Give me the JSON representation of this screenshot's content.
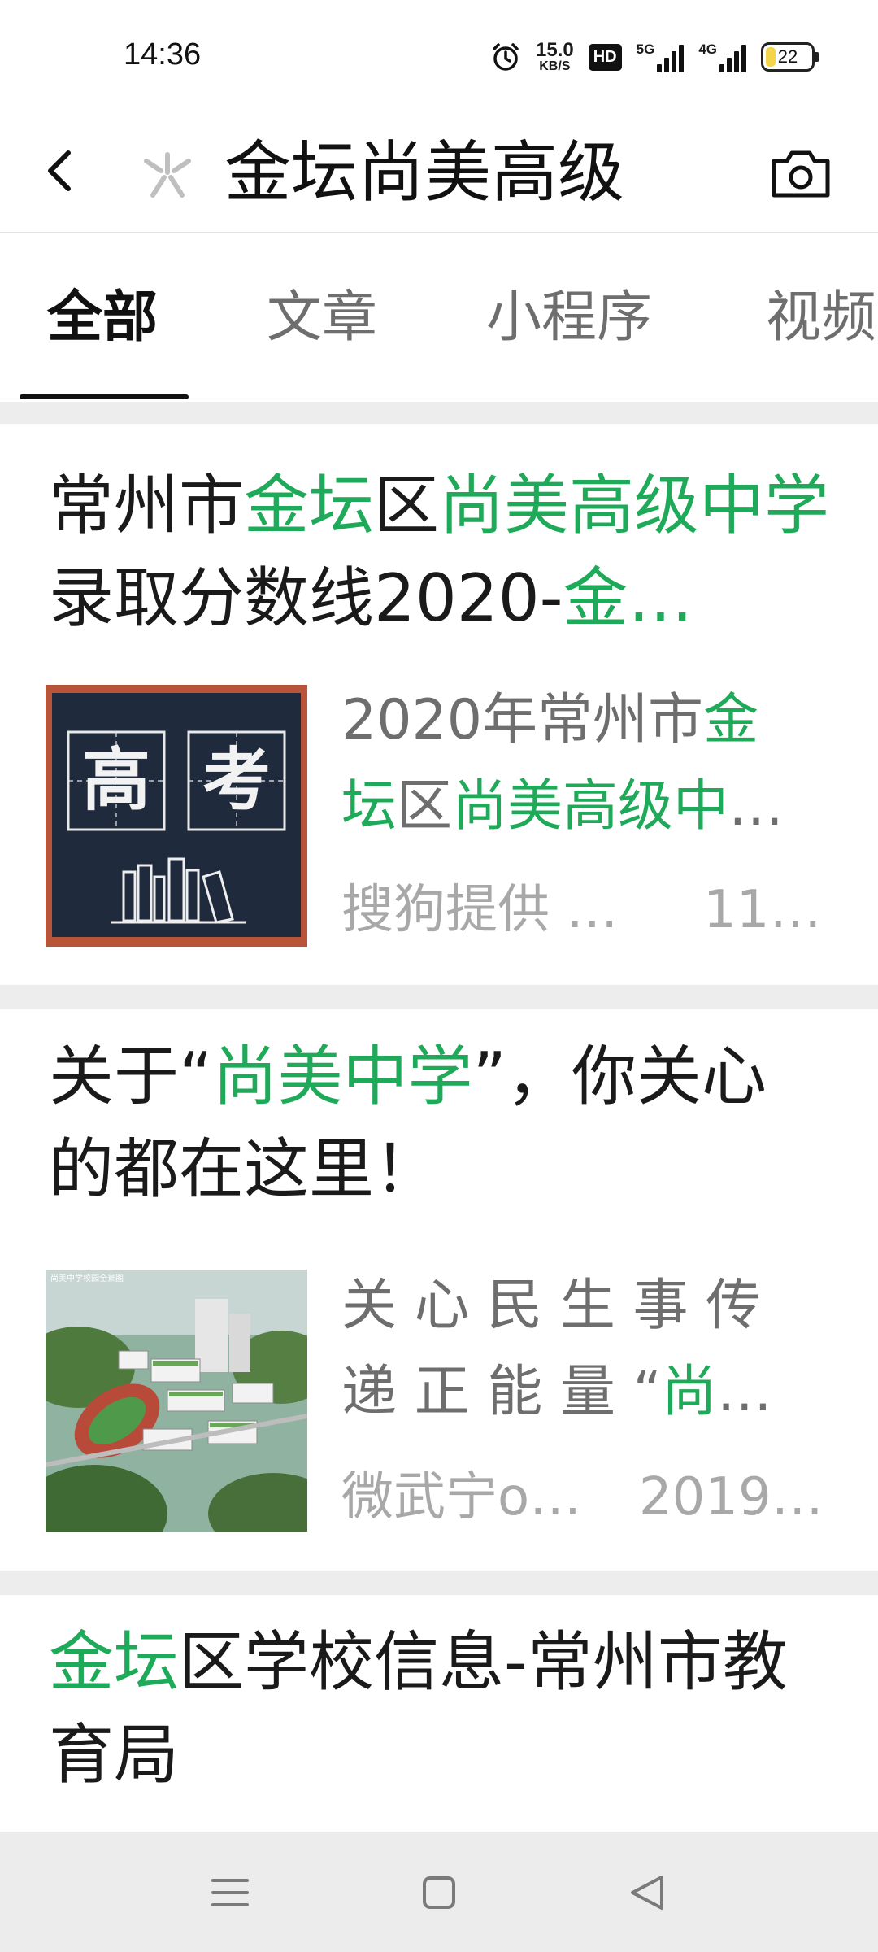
{
  "status_bar": {
    "time": "14:36",
    "net_speed_value": "15.0",
    "net_speed_unit": "KB/S",
    "hd_label": "HD",
    "signal1_label": "5G",
    "signal2_label": "4G",
    "battery_level": "22",
    "battery_fraction": 0.22
  },
  "search": {
    "query": "金坛尚美高级",
    "back_icon": "chevron-left-icon",
    "camera_icon": "camera-icon"
  },
  "tabs": [
    {
      "label": "全部",
      "active": true
    },
    {
      "label": "文章",
      "active": false
    },
    {
      "label": "小程序",
      "active": false
    },
    {
      "label": "视频",
      "active": false
    }
  ],
  "results": [
    {
      "title_parts": [
        {
          "text": "常州市",
          "hl": false
        },
        {
          "text": "金坛",
          "hl": true
        },
        {
          "text": "区",
          "hl": false
        },
        {
          "text": "尚美高级中学",
          "hl": true
        },
        {
          "text": "录取分数线2020-",
          "hl": false
        },
        {
          "text": "金…",
          "hl": true
        }
      ],
      "thumb_chars": [
        "高",
        "考"
      ],
      "snippet_line1_parts": [
        {
          "text": "2020年常州市",
          "hl": false
        },
        {
          "text": "金",
          "hl": true
        }
      ],
      "snippet_line2_parts": [
        {
          "text": "坛",
          "hl": true
        },
        {
          "text": "区",
          "hl": false
        },
        {
          "text": "尚美高级中",
          "hl": true
        },
        {
          "text": "…",
          "hl": false
        }
      ],
      "source": "搜狗提供 …",
      "date": "11…"
    },
    {
      "title_parts": [
        {
          "text": "关于“",
          "hl": false
        },
        {
          "text": "尚美中学",
          "hl": true
        },
        {
          "text": "”，你关心的都在这里！",
          "hl": false
        }
      ],
      "thumb_caption": "尚美中学校园全景图",
      "snippet_line1_parts": [
        {
          "text": "关 心 民 生 事 传",
          "hl": false
        }
      ],
      "snippet_line2_parts": [
        {
          "text": "递 正 能 量 “",
          "hl": false
        },
        {
          "text": "尚",
          "hl": true
        },
        {
          "text": "…",
          "hl": false
        }
      ],
      "source": "微武宁o…",
      "date": "2019…"
    },
    {
      "title_parts": [
        {
          "text": "金坛",
          "hl": true
        },
        {
          "text": "区学校信息-常州市教育局",
          "hl": false
        }
      ]
    }
  ],
  "nav": {
    "menu_icon": "menu-icon",
    "home_icon": "home-square-icon",
    "back_icon": "back-triangle-icon"
  },
  "colors": {
    "highlight": "#1faa5a",
    "background": "#ededed"
  }
}
